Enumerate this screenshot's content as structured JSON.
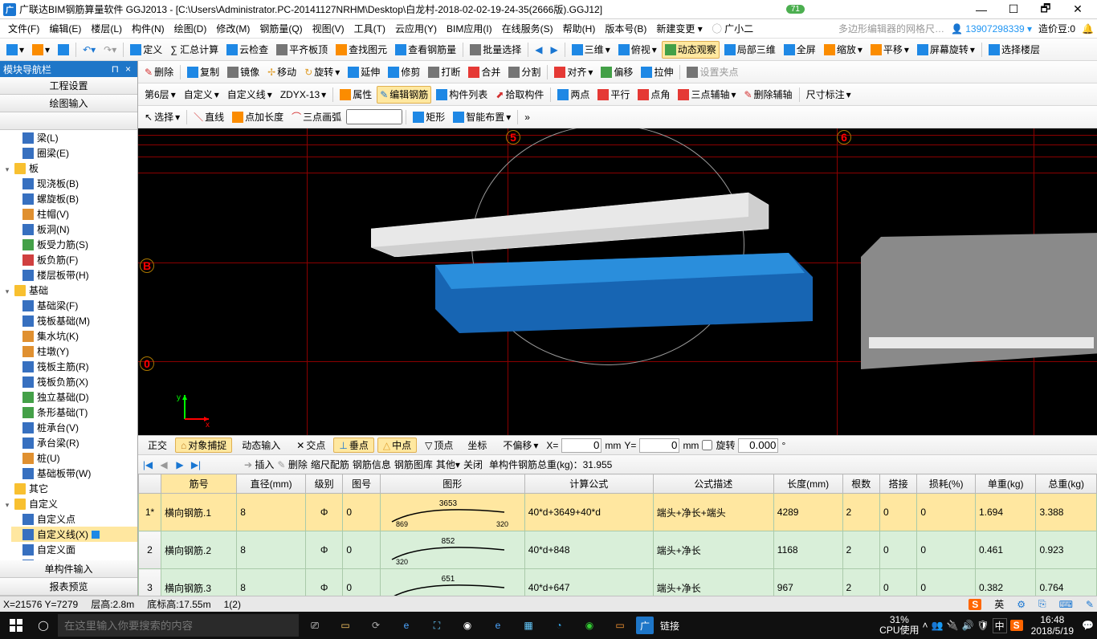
{
  "titlebar": {
    "icon_letter": "广",
    "title": "广联达BIM钢筋算量软件 GGJ2013 - [C:\\Users\\Administrator.PC-20141127NRHM\\Desktop\\白龙村-2018-02-02-19-24-35(2666版).GGJ12]",
    "badge": "71",
    "minimize": "—",
    "maximize": "☐",
    "restore": "🗗",
    "close": "✕"
  },
  "menubar": {
    "items": [
      "文件(F)",
      "编辑(E)",
      "楼层(L)",
      "构件(N)",
      "绘图(D)",
      "修改(M)",
      "钢筋量(Q)",
      "视图(V)",
      "工具(T)",
      "云应用(Y)",
      "BIM应用(I)",
      "在线服务(S)",
      "帮助(H)",
      "版本号(B)"
    ],
    "new_change": "新建变更",
    "owner": "广小二",
    "hint": "多边形编辑器的网格尺…",
    "user": "13907298339",
    "coin_label": "造价豆:0"
  },
  "toolbar1": {
    "define": "定义",
    "sum": "∑ 汇总计算",
    "cloud": "云检查",
    "flat": "平齐板顶",
    "findview": "查找图元",
    "rebarview": "查看钢筋量",
    "batch": "批量选择",
    "threed": "三维",
    "elevation": "俯视",
    "dynview": "动态观察",
    "local3d": "局部三维",
    "fullscreen": "全屏",
    "zoom": "缩放",
    "pan": "平移",
    "screenrot": "屏幕旋转",
    "selfloor": "选择楼层"
  },
  "toolbar2": {
    "delete": "删除",
    "copy": "复制",
    "mirror": "镜像",
    "move": "移动",
    "rotate": "旋转",
    "extend": "延伸",
    "trim": "修剪",
    "break": "打断",
    "merge": "合并",
    "split": "分割",
    "align": "对齐",
    "offset": "偏移",
    "stretch": "拉伸",
    "setclip": "设置夹点"
  },
  "toolbar3": {
    "floor": "第6层",
    "custom": "自定义",
    "customline": "自定义线",
    "code": "ZDYX-13",
    "props": "属性",
    "editrebar": "编辑钢筋",
    "elemlist": "构件列表",
    "pick": "拾取构件",
    "twopt": "两点",
    "parallel": "平行",
    "angle": "点角",
    "threeaxis": "三点辅轴",
    "delaxis": "删除辅轴",
    "dim": "尺寸标注"
  },
  "toolbar4": {
    "select": "选择",
    "line": "直线",
    "addlen": "点加长度",
    "arc3": "三点画弧",
    "rect": "矩形",
    "smart": "智能布置"
  },
  "sidebar": {
    "title": "模块导航栏",
    "pin": "⊓",
    "close": "×",
    "nav1": "工程设置",
    "nav2": "绘图输入",
    "nav3": "单构件输入",
    "nav4": "报表预览",
    "tree": {
      "beam": "梁(L)",
      "ringbeam": "圈梁(E)",
      "board": "板",
      "castboard": "现浇板(B)",
      "spiralboard": "螺旋板(B)",
      "column_cap": "柱帽(V)",
      "boardhole": "板洞(N)",
      "boardbar": "板受力筋(S)",
      "boardneg": "板负筋(F)",
      "floorband": "楼层板带(H)",
      "foundation": "基础",
      "basebeam": "基础梁(F)",
      "raft": "筏板基础(M)",
      "sump": "集水坑(K)",
      "stub": "柱墩(Y)",
      "raftmain": "筏板主筋(R)",
      "raftneg": "筏板负筋(X)",
      "isolated": "独立基础(D)",
      "strip": "条形基础(T)",
      "pilecap": "桩承台(V)",
      "capbeam": "承台梁(R)",
      "pile": "桩(U)",
      "baseband": "基础板带(W)",
      "other": "其它",
      "customfolder": "自定义",
      "custompt": "自定义点",
      "customln": "自定义线(X)",
      "customface": "自定义面",
      "dimlabel": "尺寸标注(W)"
    }
  },
  "viewport": {
    "label5": "5",
    "label6": "6",
    "labelB": "B",
    "label0": "0"
  },
  "coordbar": {
    "ortho": "正交",
    "osnap": "对象捕捉",
    "dyninput": "动态输入",
    "intersect": "交点",
    "perp": "垂点",
    "mid": "中点",
    "vertex": "顶点",
    "coord": "坐标",
    "nooffset": "不偏移",
    "x_label": "X=",
    "x_val": "0",
    "x_unit": "mm",
    "y_label": "Y=",
    "y_val": "0",
    "y_unit": "mm",
    "rotate": "旋转",
    "angle": "0.000"
  },
  "datatoolbar": {
    "insert": "插入",
    "delete": "删除",
    "scaledim": "缩尺配筋",
    "rebarinfo": "钢筋信息",
    "rebarlib": "钢筋图库",
    "other": "其他",
    "close": "关闭",
    "total": "单构件钢筋总重(kg)：31.955"
  },
  "table": {
    "headers": [
      "筋号",
      "直径(mm)",
      "级别",
      "图号",
      "图形",
      "计算公式",
      "公式描述",
      "长度(mm)",
      "根数",
      "搭接",
      "损耗(%)",
      "单重(kg)",
      "总重(kg)"
    ],
    "rows": [
      {
        "idx": "1*",
        "name": "横向钢筋.1",
        "dia": "8",
        "grade": "Φ",
        "fig": "0",
        "shape": {
          "t": "3653",
          "l": "869",
          "r": "320"
        },
        "formula": "40*d+3649+40*d",
        "desc": "端头+净长+端头",
        "len": "4289",
        "n": "2",
        "lap": "0",
        "loss": "0",
        "uw": "1.694",
        "tw": "3.388"
      },
      {
        "idx": "2",
        "name": "横向钢筋.2",
        "dia": "8",
        "grade": "Φ",
        "fig": "0",
        "shape": {
          "t": "852",
          "l": "320"
        },
        "formula": "40*d+848",
        "desc": "端头+净长",
        "len": "1168",
        "n": "2",
        "lap": "0",
        "loss": "0",
        "uw": "0.461",
        "tw": "0.923"
      },
      {
        "idx": "3",
        "name": "横向钢筋.3",
        "dia": "8",
        "grade": "Φ",
        "fig": "0",
        "shape": {
          "t": "651",
          "r": "320"
        },
        "formula": "40*d+647",
        "desc": "端头+净长",
        "len": "967",
        "n": "2",
        "lap": "0",
        "loss": "0",
        "uw": "0.382",
        "tw": "0.764"
      }
    ]
  },
  "statusbar": {
    "coords": "X=21576 Y=7279",
    "floor": "层高:2.8m",
    "bottom": "底标高:17.55m",
    "count": "1(2)"
  },
  "taskbar": {
    "search_placeholder": "在这里输入你要搜索的内容",
    "link": "链接",
    "cpu1": "31%",
    "cpu2": "CPU使用",
    "ime": "英",
    "ime2": "中",
    "time": "16:48",
    "date": "2018/5/19"
  }
}
